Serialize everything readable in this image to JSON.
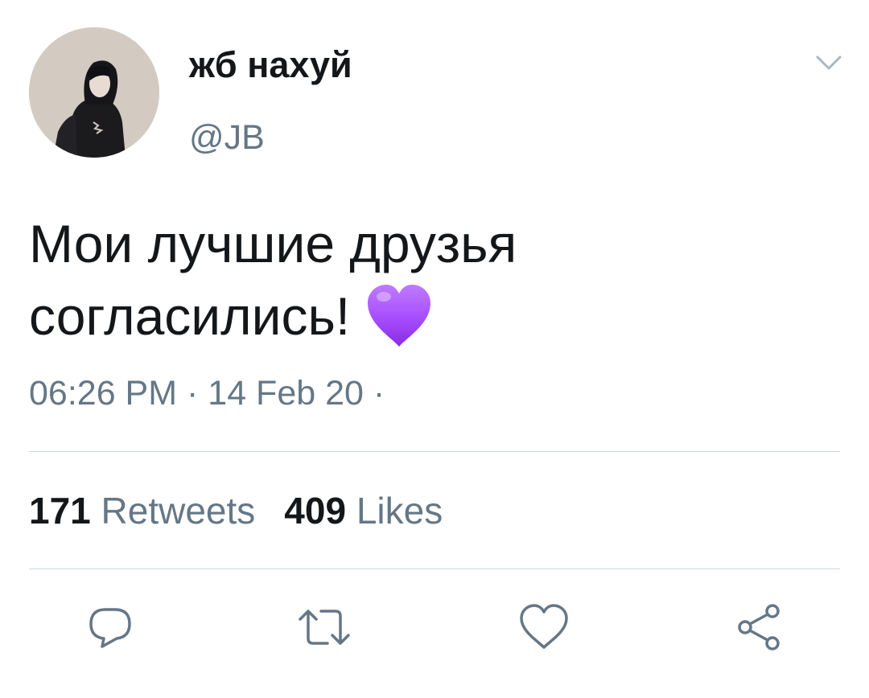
{
  "tweet": {
    "display_name": "жб нахуй",
    "handle": "@JB",
    "text_line1": "Мои лучшие друзья",
    "text_line2": "согласились!",
    "emoji": "purple-heart",
    "time": "06:26 PM",
    "date": "14 Feb 20",
    "meta_separator": " · ",
    "meta_trailing": " ·",
    "retweets_count": "171",
    "retweets_label": "Retweets",
    "likes_count": "409",
    "likes_label": "Likes"
  },
  "actions": [
    {
      "icon": "reply-icon"
    },
    {
      "icon": "retweet-icon"
    },
    {
      "icon": "like-icon"
    },
    {
      "icon": "share-icon"
    }
  ],
  "colors": {
    "text": "#14171a",
    "secondary": "#657786",
    "divider": "#ccd6dd",
    "heart": "#a64dff"
  }
}
